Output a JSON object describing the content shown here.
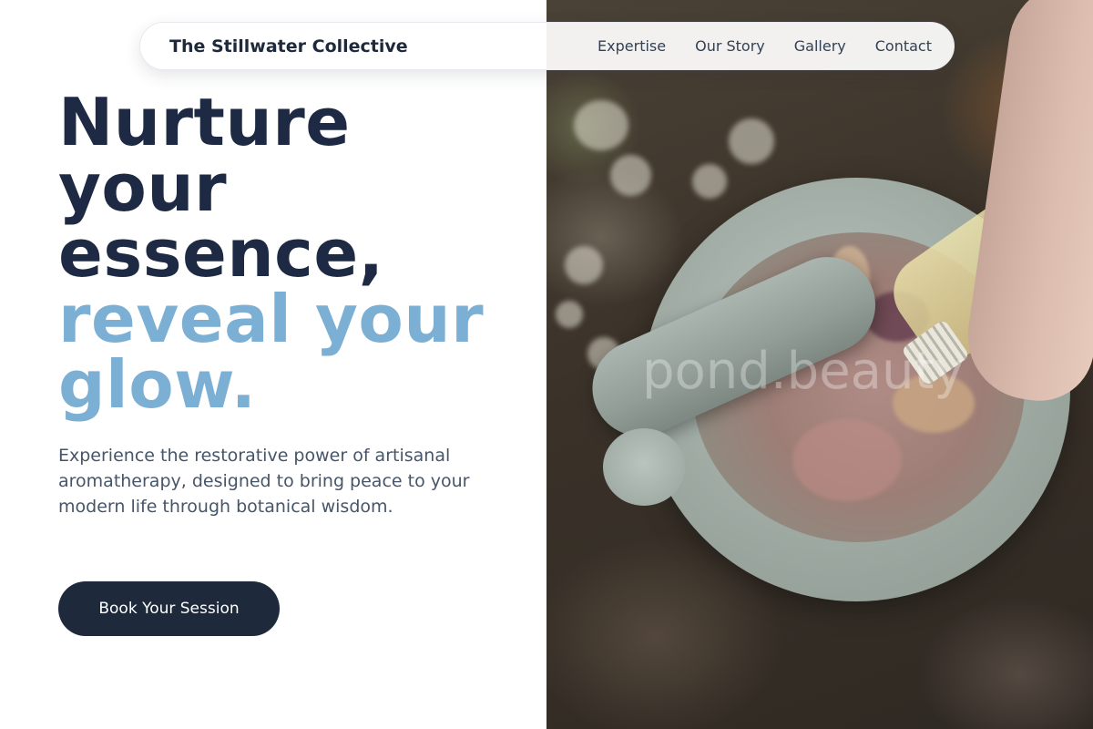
{
  "nav": {
    "brand": "The Stillwater Collective",
    "links": [
      "Expertise",
      "Our Story",
      "Gallery",
      "Contact"
    ]
  },
  "hero": {
    "headline_dark": [
      "Nurture",
      "your",
      "essence,"
    ],
    "headline_accent": [
      "reveal your",
      "glow."
    ],
    "subtext": "Experience the restorative power of artisanal aromatherapy, designed to bring peace to your modern life through botanical wisdom.",
    "cta_label": "Book Your Session",
    "image_watermark": "pond.beauty"
  },
  "colors": {
    "primary_dark": "#1e293b",
    "accent_blue": "#7bafd4",
    "body_text": "#475569"
  }
}
